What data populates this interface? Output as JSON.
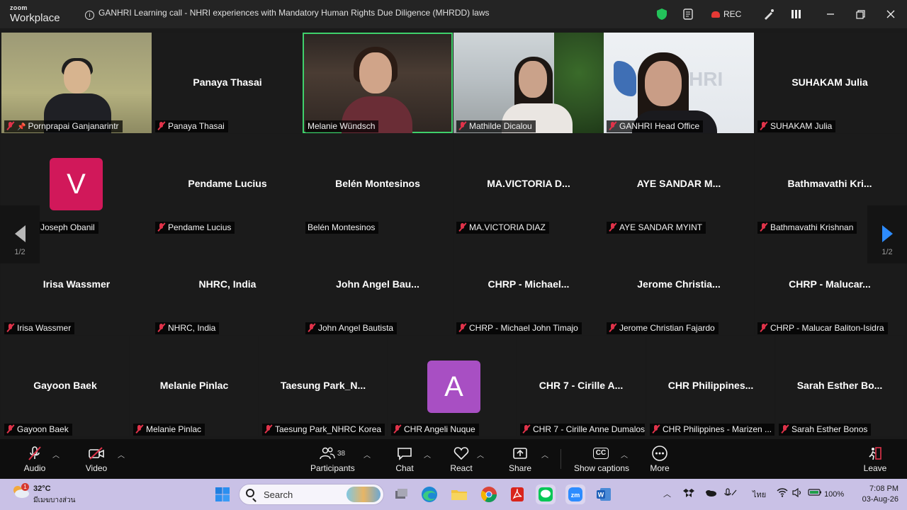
{
  "app": {
    "brand_top": "zoom",
    "brand_bottom": "Workplace"
  },
  "meeting_title": "GANHRI Learning call - NHRI experiences with Mandatory Human Rights Due Diligence (MHRDD) laws",
  "recording_label": "REC",
  "video_scene_text": {
    "nhri_logo": "HRI"
  },
  "tiles": [
    {
      "big": "",
      "label": "Pornprapai Ganjanarintr",
      "video": true,
      "pinned": true
    },
    {
      "big": "Panaya Thasai",
      "label": "Panaya Thasai"
    },
    {
      "big": "",
      "label": "Melanie Wündsch",
      "video": true,
      "active": true,
      "muted": false
    },
    {
      "big": "",
      "label": "Mathilde Dicalou",
      "video": true
    },
    {
      "big": "",
      "label": "GANHRI Head Office",
      "video": true
    },
    {
      "big": "SUHAKAM Julia",
      "label": "SUHAKAM Julia"
    },
    {
      "big": "",
      "label": "Joseph Obanil",
      "avatar": "V",
      "avatar_color": "#d1185a",
      "muted": false
    },
    {
      "big": "Pendame Lucius",
      "label": "Pendame Lucius"
    },
    {
      "big": "Belén Montesinos",
      "label": "Belén Montesinos",
      "muted": false
    },
    {
      "big": "MA.VICTORIA  D...",
      "label": "MA.VICTORIA DIAZ"
    },
    {
      "big": "AYE SANDAR M...",
      "label": "AYE SANDAR MYINT"
    },
    {
      "big": "Bathmavathi Kri...",
      "label": "Bathmavathi Krishnan"
    },
    {
      "big": "Irisa Wassmer",
      "label": "Irisa Wassmer"
    },
    {
      "big": "NHRC, India",
      "label": "NHRC, India"
    },
    {
      "big": "John  Angel Bau...",
      "label": "John Angel Bautista"
    },
    {
      "big": "CHRP  -  Michael...",
      "label": "CHRP - Michael John Timajo"
    },
    {
      "big": "Jerome  Christia...",
      "label": "Jerome Christian Fajardo"
    },
    {
      "big": "CHRP  -  Malucar...",
      "label": "CHRP - Malucar Baliton-Isidra"
    },
    {
      "big": "Gayoon Baek",
      "label": "Gayoon Baek"
    },
    {
      "big": "Melanie Pinlac",
      "label": "Melanie Pinlac"
    },
    {
      "big": "Taesung  Park_N...",
      "label": "Taesung Park_NHRC Korea"
    },
    {
      "big": "",
      "label": "CHR Angeli Nuque",
      "avatar": "A",
      "avatar_color": "#a84fc3"
    },
    {
      "big": "CHR 7  -  Cirille A...",
      "label": "CHR 7 - Cirille Anne Dumalos"
    },
    {
      "big": "CHR  Philippines...",
      "label": "CHR Philippines - Marizen ..."
    },
    {
      "big": "Sarah Esther Bo...",
      "label": "Sarah Esther Bonos"
    }
  ],
  "pager": {
    "left": "1/2",
    "right": "1/2"
  },
  "controls": {
    "audio": "Audio",
    "video": "Video",
    "participants": "Participants",
    "participants_count": "38",
    "chat": "Chat",
    "react": "React",
    "share": "Share",
    "captions": "Show captions",
    "captions_icon": "CC",
    "more": "More",
    "leave": "Leave"
  },
  "taskbar": {
    "temperature": "32°C",
    "weather_badge": "1",
    "date_thai": "มีเมฆบางส่วน",
    "search_placeholder": "Search",
    "lang": "ไทย",
    "battery": "100%",
    "time": "7:08 PM",
    "date": "03-Aug-26"
  },
  "colors": {
    "active_speaker": "#3fd06b",
    "muted": "#e0334a",
    "pager_arrow": "#2d8cff",
    "taskbar": "#c9c1e6"
  }
}
